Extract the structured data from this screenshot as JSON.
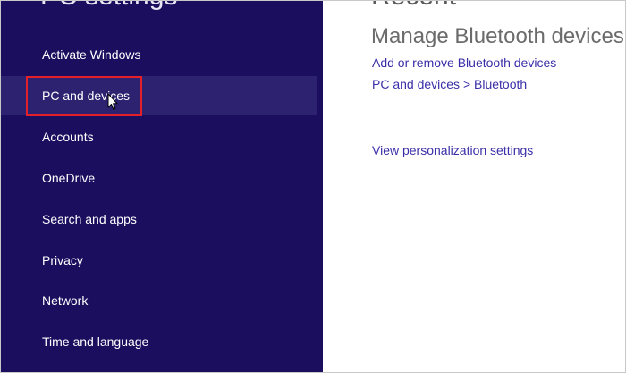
{
  "sidebar": {
    "title": "PC settings",
    "items": [
      {
        "label": "Activate Windows"
      },
      {
        "label": "PC and devices"
      },
      {
        "label": "Accounts"
      },
      {
        "label": "OneDrive"
      },
      {
        "label": "Search and apps"
      },
      {
        "label": "Privacy"
      },
      {
        "label": "Network"
      },
      {
        "label": "Time and language"
      }
    ]
  },
  "main": {
    "title": "Recent",
    "section_heading": "Manage Bluetooth devices",
    "links": [
      {
        "label": "Add or remove Bluetooth devices"
      },
      {
        "label": "PC and devices > Bluetooth"
      },
      {
        "label": "View personalization settings"
      }
    ]
  },
  "colors": {
    "sidebar_bg": "#1b0e5e",
    "selected_bg": "#2c2270",
    "link": "#3a2fa8",
    "highlight_box": "#e5202b"
  },
  "icons": {
    "cursor": "mouse-pointer-icon"
  }
}
